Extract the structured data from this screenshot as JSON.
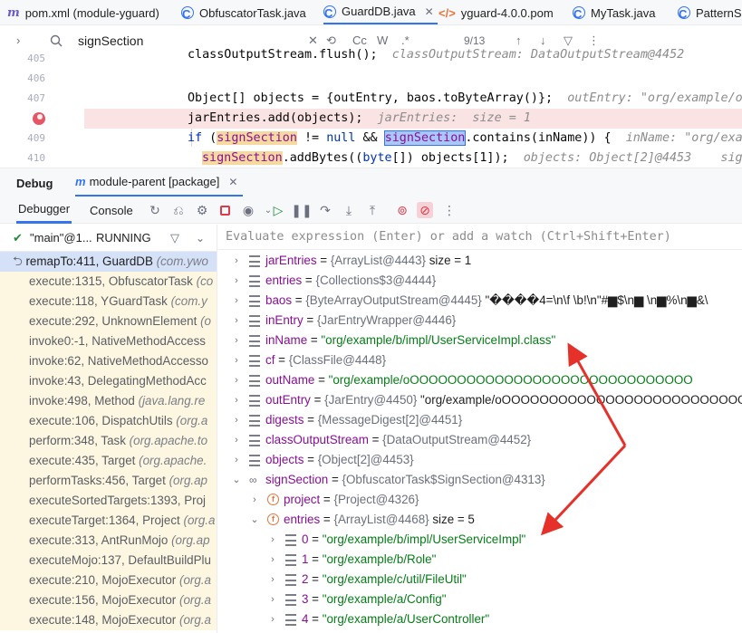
{
  "tabs": [
    {
      "label": "pom.xml (module-yguard)",
      "icon": "maven-icon"
    },
    {
      "label": "ObfuscatorTask.java",
      "icon": "class-icon"
    },
    {
      "label": "GuardDB.java",
      "icon": "class-icon",
      "active": true
    },
    {
      "label": "yguard-4.0.0.pom",
      "icon": "xml-icon"
    },
    {
      "label": "MyTask.java",
      "icon": "class-icon"
    },
    {
      "label": "PatternS",
      "icon": "class-icon"
    }
  ],
  "search": {
    "query": "signSection",
    "match_count": "9/13",
    "options": {
      "cc": "Cc",
      "w": "W",
      "regex": ".*"
    }
  },
  "editor": {
    "line_numbers": [
      "405",
      "406",
      "407",
      "408",
      "409",
      "410"
    ],
    "lines": {
      "l405": "classOutputStream.flush();",
      "l405_hint": "classOutputStream: DataOutputStream@4452",
      "l406": "Object[] objects = {outEntry, baos.toByteArray()};",
      "l406_hint": "outEntry: \"org/example/o",
      "l407": "jarEntries.add(objects);",
      "l407_hint": "jarEntries:  size = 1",
      "l408_if": "if",
      "l408_a": " (",
      "l408_var1": "signSection",
      "l408_b": " != ",
      "l408_null": "null",
      "l408_c": " && ",
      "l408_var2": "signSection",
      "l408_d": ".contains(inName)) {",
      "l408_hint": "inName: \"org/exa",
      "l409_var": "signSection",
      "l409_a": ".addBytes((",
      "l409_byte": "byte",
      "l409_b": "[]) objects[1]);",
      "l409_hint": "objects: Object[2]@4453    sig",
      "l410": "}"
    }
  },
  "debug": {
    "title": "Debug",
    "session": "module-parent [package]",
    "tabs": {
      "debugger": "Debugger",
      "console": "Console"
    },
    "thread": {
      "name": "\"main\"@1...",
      "state": "RUNNING"
    },
    "frames": [
      {
        "method": "remapTo:411, GuardDB",
        "cls": "(com.ywo"
      },
      {
        "method": "execute:1315, ObfuscatorTask",
        "cls": "(co"
      },
      {
        "method": "execute:118, YGuardTask",
        "cls": "(com.y"
      },
      {
        "method": "execute:292, UnknownElement",
        "cls": "(o"
      },
      {
        "method": "invoke0:-1, NativeMethodAccess",
        "cls": ""
      },
      {
        "method": "invoke:62, NativeMethodAccesso",
        "cls": ""
      },
      {
        "method": "invoke:43, DelegatingMethodAcc",
        "cls": ""
      },
      {
        "method": "invoke:498, Method",
        "cls": "(java.lang.re"
      },
      {
        "method": "execute:106, DispatchUtils",
        "cls": "(org.a"
      },
      {
        "method": "perform:348, Task",
        "cls": "(org.apache.to"
      },
      {
        "method": "execute:435, Target",
        "cls": "(org.apache."
      },
      {
        "method": "performTasks:456, Target",
        "cls": "(org.ap"
      },
      {
        "method": "executeSortedTargets:1393, Proj",
        "cls": ""
      },
      {
        "method": "executeTarget:1364, Project",
        "cls": "(org.a"
      },
      {
        "method": "execute:313, AntRunMojo",
        "cls": "(org.ap"
      },
      {
        "method": "executeMojo:137, DefaultBuildPlu",
        "cls": ""
      },
      {
        "method": "execute:210, MojoExecutor",
        "cls": "(org.a"
      },
      {
        "method": "execute:156, MojoExecutor",
        "cls": "(org.a"
      },
      {
        "method": "execute:148, MojoExecutor",
        "cls": "(org.a"
      }
    ],
    "eval_placeholder": "Evaluate expression (Enter) or add a watch (Ctrl+Shift+Enter)",
    "variables": [
      {
        "name": "jarEntries",
        "eq": " = ",
        "type": "{ArrayList@4443}",
        "rest": " size = 1",
        "icon": "list",
        "depth": 0,
        "chev": "›"
      },
      {
        "name": "entries",
        "eq": " = ",
        "type": "{Collections$3@4444}",
        "rest": "",
        "icon": "list",
        "depth": 0,
        "chev": "›"
      },
      {
        "name": "baos",
        "eq": " = ",
        "type": "{ByteArrayOutputStream@4445}",
        "rest": " \"����4=\\n\\f \\b!\\n\"#▆$\\n▆ \\n▆%\\n▆&\\",
        "icon": "list",
        "depth": 0,
        "chev": "›"
      },
      {
        "name": "inEntry",
        "eq": " = ",
        "type": "{JarEntryWrapper@4446}",
        "rest": "",
        "icon": "list",
        "depth": 0,
        "chev": "›"
      },
      {
        "name": "inName",
        "eq": " = ",
        "type": "",
        "str": "\"org/example/b/impl/UserServiceImpl.class\"",
        "icon": "list",
        "depth": 0,
        "chev": "›"
      },
      {
        "name": "cf",
        "eq": " = ",
        "type": "{ClassFile@4448}",
        "rest": "",
        "icon": "list",
        "depth": 0,
        "chev": "›"
      },
      {
        "name": "outName",
        "eq": " = ",
        "type": "",
        "str": "\"org/example/oOOOOOOOOOOOOOOOOOOOOOOOOOOOOOO",
        "icon": "list",
        "depth": 0,
        "chev": "›"
      },
      {
        "name": "outEntry",
        "eq": " = ",
        "type": "{JarEntry@4450}",
        "rest": " \"org/example/oOOOOOOOOOOOOOOOOOOOOOOOOOOO",
        "icon": "list",
        "depth": 0,
        "chev": "›"
      },
      {
        "name": "digests",
        "eq": " = ",
        "type": "{MessageDigest[2]@4451}",
        "rest": "",
        "icon": "list",
        "depth": 0,
        "chev": "›"
      },
      {
        "name": "classOutputStream",
        "eq": " = ",
        "type": "{DataOutputStream@4452}",
        "rest": "",
        "icon": "list",
        "depth": 0,
        "chev": "›"
      },
      {
        "name": "objects",
        "eq": " = ",
        "type": "{Object[2]@4453}",
        "rest": "",
        "icon": "list",
        "depth": 0,
        "chev": "›"
      },
      {
        "name": "signSection",
        "eq": " = ",
        "type": "{ObfuscatorTask$SignSection@4313}",
        "rest": "",
        "icon": "oo",
        "depth": 0,
        "chev": "⌄"
      },
      {
        "name": "project",
        "eq": " = ",
        "type": "{Project@4326}",
        "rest": "",
        "icon": "f",
        "depth": 1,
        "chev": "›"
      },
      {
        "name": "entries",
        "eq": " = ",
        "type": "{ArrayList@4468}",
        "rest": " size = 5",
        "icon": "f",
        "depth": 1,
        "chev": "⌄"
      },
      {
        "name": "0",
        "eq": " = ",
        "type": "",
        "str": "\"org/example/b/impl/UserServiceImpl\"",
        "icon": "list",
        "depth": 2,
        "chev": "›"
      },
      {
        "name": "1",
        "eq": " = ",
        "type": "",
        "str": "\"org/example/b/Role\"",
        "icon": "list",
        "depth": 2,
        "chev": "›"
      },
      {
        "name": "2",
        "eq": " = ",
        "type": "",
        "str": "\"org/example/c/util/FileUtil\"",
        "icon": "list",
        "depth": 2,
        "chev": "›"
      },
      {
        "name": "3",
        "eq": " = ",
        "type": "",
        "str": "\"org/example/a/Config\"",
        "icon": "list",
        "depth": 2,
        "chev": "›"
      },
      {
        "name": "4",
        "eq": " = ",
        "type": "",
        "str": "\"org/example/a/UserController\"",
        "icon": "list",
        "depth": 2,
        "chev": "›"
      }
    ]
  },
  "colors": {
    "accent": "#3574f0",
    "annotation_arrow": "#e5312a",
    "string": "#067d17",
    "field": "#871094",
    "keyword": "#0033b3"
  }
}
